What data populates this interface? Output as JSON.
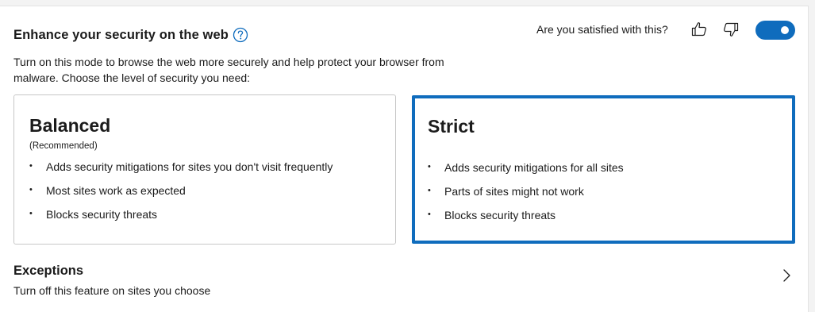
{
  "section": {
    "title": "Enhance your security on the web",
    "help_icon": "question-circle-icon",
    "feedback_question": "Are you satisfied with this?",
    "toggle_on": true,
    "accent_color": "#0f6cbd",
    "description": "Turn on this mode to browse the web more securely and help protect your browser from malware. Choose the level of security you need:"
  },
  "cards": {
    "balanced": {
      "title": "Balanced",
      "subtitle": "(Recommended)",
      "selected": false,
      "bullets": [
        "Adds security mitigations for sites you don't visit frequently",
        "Most sites work as expected",
        "Blocks security threats"
      ]
    },
    "strict": {
      "title": "Strict",
      "selected": true,
      "bullets": [
        "Adds security mitigations for all sites",
        "Parts of sites might not work",
        "Blocks security threats"
      ]
    }
  },
  "exceptions": {
    "title": "Exceptions",
    "description": "Turn off this feature on sites you choose",
    "chevron_icon": "chevron-right-icon"
  }
}
